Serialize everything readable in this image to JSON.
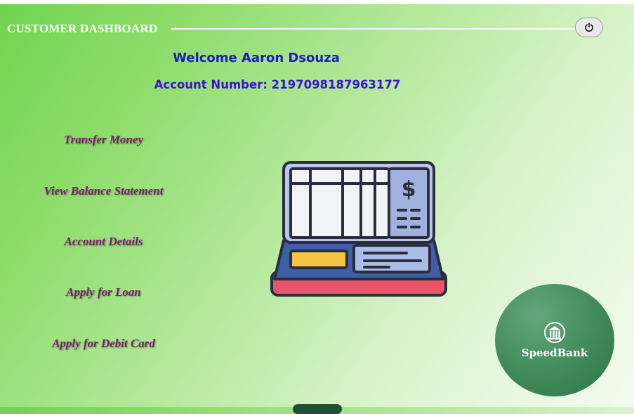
{
  "header": {
    "title": "CUSTOMER DASHBOARD",
    "logout_icon": "power-icon"
  },
  "welcome": {
    "greeting": "Welcome Aaron Dsouza",
    "account_number": "Account Number: 2197098187963177"
  },
  "menu": {
    "items": [
      {
        "label": "Transfer Money"
      },
      {
        "label": "View Balance Statement"
      },
      {
        "label": "Account Details"
      },
      {
        "label": "Apply for Loan"
      },
      {
        "label": "Apply for Debit Card"
      }
    ]
  },
  "illustration": {
    "icon": "pos-terminal-icon"
  },
  "brand": {
    "name": "SpeedBank",
    "icon": "bank-icon"
  },
  "colors": {
    "title_text": "#ffffff",
    "greeting": "#1a1fb8",
    "account": "#3a12d6",
    "menu_text": "#7a1c6f",
    "brand_circle": "#3f8a58"
  }
}
